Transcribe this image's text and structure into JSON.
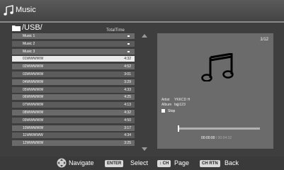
{
  "header": {
    "title": "Music"
  },
  "browser": {
    "path": "/USB/",
    "column_header": "TotalTime"
  },
  "files": [
    {
      "name": "Music 1",
      "time": "",
      "kind": "folder"
    },
    {
      "name": "Music 2",
      "time": "",
      "kind": "folder"
    },
    {
      "name": "Music 3",
      "time": "",
      "kind": "folder"
    },
    {
      "name": "01WWWWW",
      "time": "4:32",
      "selected": true
    },
    {
      "name": "02WWWWW",
      "time": "4:52"
    },
    {
      "name": "03WWWWW",
      "time": "3:01"
    },
    {
      "name": "04WWWWW",
      "time": "3:29"
    },
    {
      "name": "05WWWWW",
      "time": "4:33"
    },
    {
      "name": "06WWWWW",
      "time": "4:25"
    },
    {
      "name": "07WWWWW",
      "time": "4:13"
    },
    {
      "name": "08WWWWW",
      "time": "4:32"
    },
    {
      "name": "09WWWWW",
      "time": "4:50"
    },
    {
      "name": "10WWWWW",
      "time": "3:17"
    },
    {
      "name": "11WWWWW",
      "time": "4:34"
    },
    {
      "name": "12WWWWW",
      "time": "3:25"
    }
  ],
  "preview": {
    "page_count": "1/12",
    "artist_label": "Artist",
    "artist": "YKKCD H",
    "album_label": "Album",
    "album": "fajji123",
    "stop_label": "Stop",
    "current_time": "00:00:00",
    "separator": "/",
    "total_time": "00:04:32",
    "progress_fraction": 0.0
  },
  "footer": {
    "navigate": "Navigate",
    "enter_key": "ENTER",
    "select": "Select",
    "ch_key": "CH",
    "page": "Page",
    "rtn_key": "CH RTN",
    "back": "Back"
  }
}
